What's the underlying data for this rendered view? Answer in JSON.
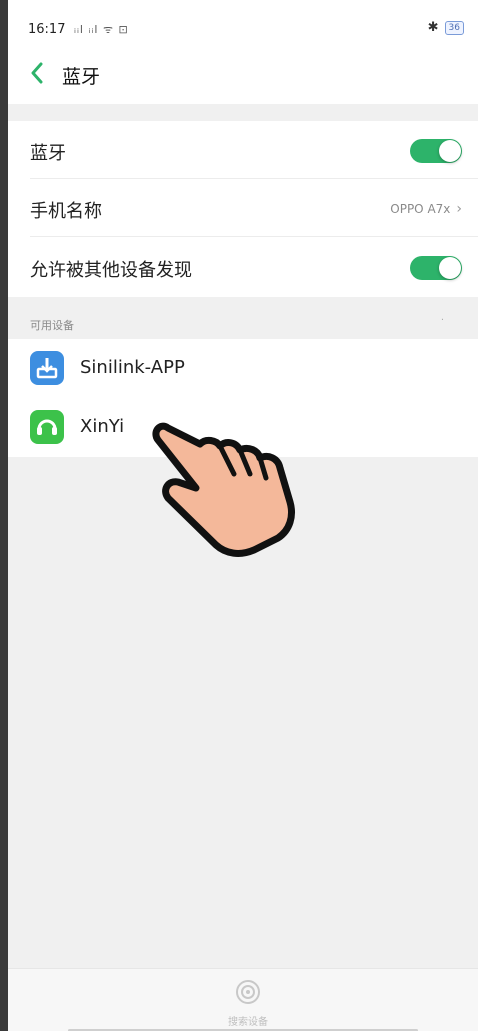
{
  "status_bar": {
    "time": "16:17",
    "signal_text": "ᵢᵢl ᵢᵢl ᯤ ⊡",
    "bluetooth_icon": "bluetooth-icon",
    "battery": "36"
  },
  "header": {
    "title": "蓝牙"
  },
  "settings": {
    "bluetooth_label": "蓝牙",
    "bluetooth_on": true,
    "phone_name_label": "手机名称",
    "phone_name_value": "OPPO A7x",
    "discoverable_label": "允许被其他设备发现",
    "discoverable_on": true
  },
  "available": {
    "section_label": "可用设备",
    "devices": [
      {
        "name": "Sinilink-APP",
        "icon": "sinilink-app-icon"
      },
      {
        "name": "XinYi",
        "icon": "xinyi-app-icon"
      }
    ]
  },
  "bottom": {
    "search_label": "搜索设备"
  },
  "colors": {
    "accent": "#2db36a",
    "toggle_on": "#2db36a",
    "sinilink_icon": "#3d8ee0",
    "xinyi_icon": "#3cc24a",
    "hand_fill": "#f4b89a"
  }
}
